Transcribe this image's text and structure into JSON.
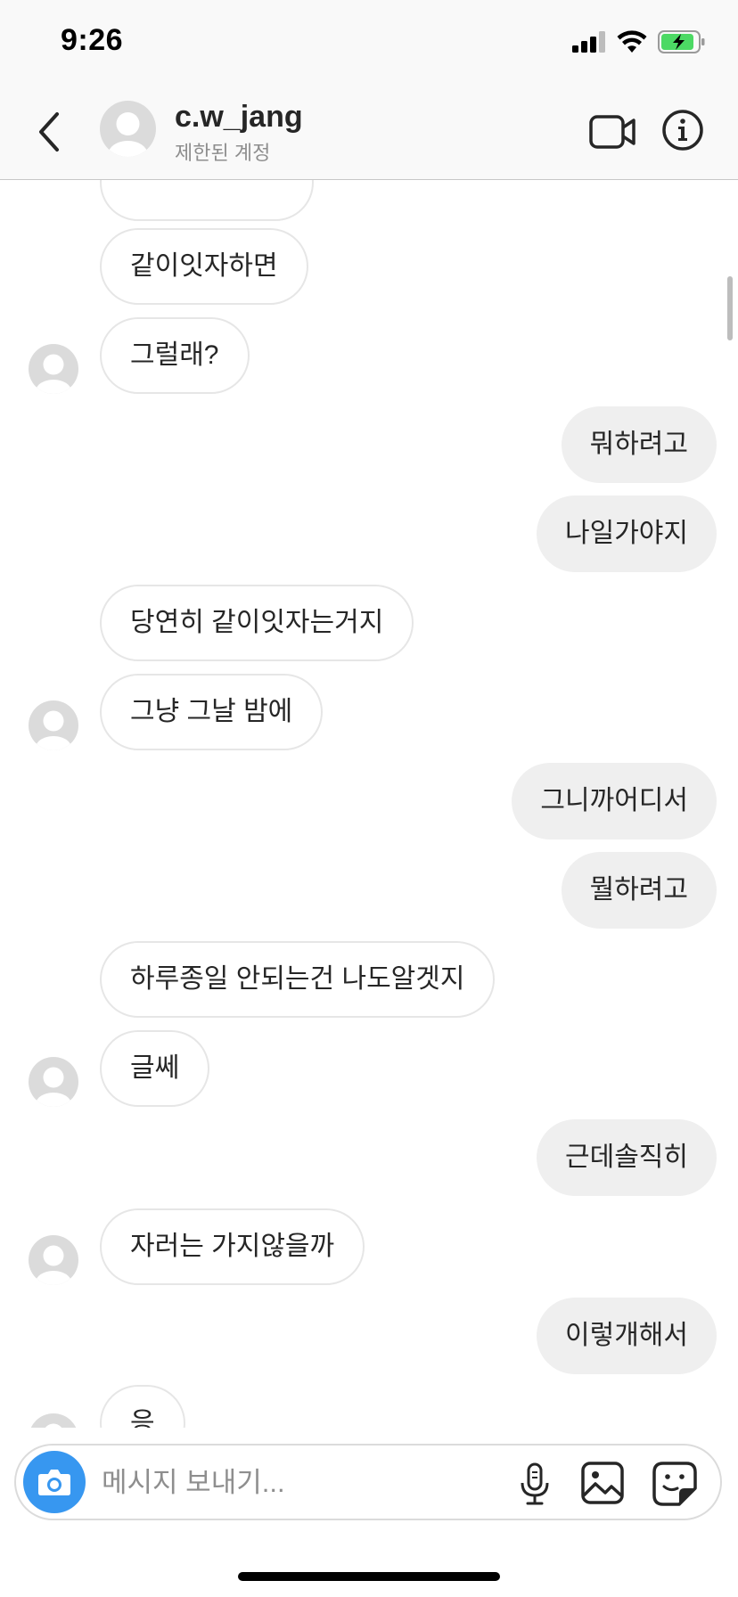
{
  "status_bar": {
    "time": "9:26"
  },
  "header": {
    "username": "c.w_jang",
    "subtitle": "제한된 계정"
  },
  "messages": [
    {
      "side": "in",
      "text": "같이잇자하면"
    },
    {
      "side": "in",
      "text": "그럴래?"
    },
    {
      "side": "out",
      "text": "뭐하려고"
    },
    {
      "side": "out",
      "text": "나일가야지"
    },
    {
      "side": "in",
      "text": "당연히 같이잇자는거지"
    },
    {
      "side": "in",
      "text": "그냥 그날 밤에"
    },
    {
      "side": "out",
      "text": "그니까어디서"
    },
    {
      "side": "out",
      "text": "뭘하려고"
    },
    {
      "side": "in",
      "text": "하루종일 안되는건 나도알겟지"
    },
    {
      "side": "in",
      "text": "글쎄"
    },
    {
      "side": "out",
      "text": "근데솔직히"
    },
    {
      "side": "in",
      "text": "자러는 가지않을까"
    },
    {
      "side": "out",
      "text": "이렇개해서"
    },
    {
      "side": "in",
      "text": "응"
    }
  ],
  "composer": {
    "placeholder": "메시지 보내기..."
  },
  "colors": {
    "accent_blue": "#3797f0",
    "incoming_border": "#e6e6e6",
    "outgoing_bg": "#efefef",
    "secondary_text": "#8e8e8e",
    "battery_green": "#4cd964"
  },
  "icons": {
    "back": "chevron-left-icon",
    "video": "video-camera-icon",
    "info": "info-icon",
    "camera": "camera-icon",
    "mic": "microphone-icon",
    "gallery": "image-icon",
    "sticker": "sticker-icon"
  }
}
